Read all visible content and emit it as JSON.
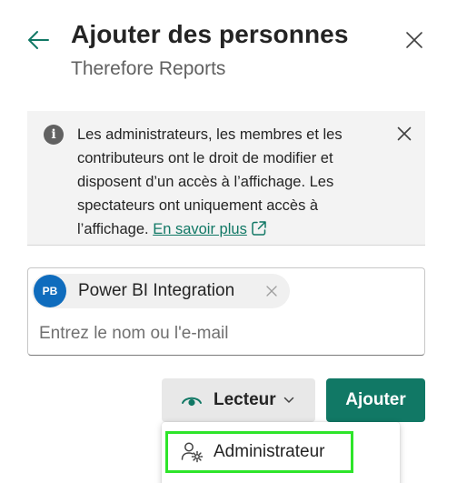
{
  "header": {
    "title": "Ajouter des personnes",
    "subtitle": "Therefore Reports"
  },
  "info": {
    "text": "Les administrateurs, les membres et les contributeurs ont le droit de modifier et disposent d’un accès à l’affichage. Les spectateurs ont uniquement accès à l’affichage.",
    "link_label": "En savoir plus"
  },
  "people": {
    "chip": {
      "initials": "PB",
      "name": "Power BI Integration"
    },
    "input_placeholder": "Entrez le nom ou l'e-mail"
  },
  "actions": {
    "role_label": "Lecteur",
    "add_label": "Ajouter"
  },
  "role_menu": {
    "items": [
      {
        "label": "Administrateur",
        "icon": "admin-icon"
      }
    ]
  },
  "colors": {
    "accent": "#117865",
    "avatar": "#0f6cbd",
    "highlight": "#2ee52a"
  }
}
